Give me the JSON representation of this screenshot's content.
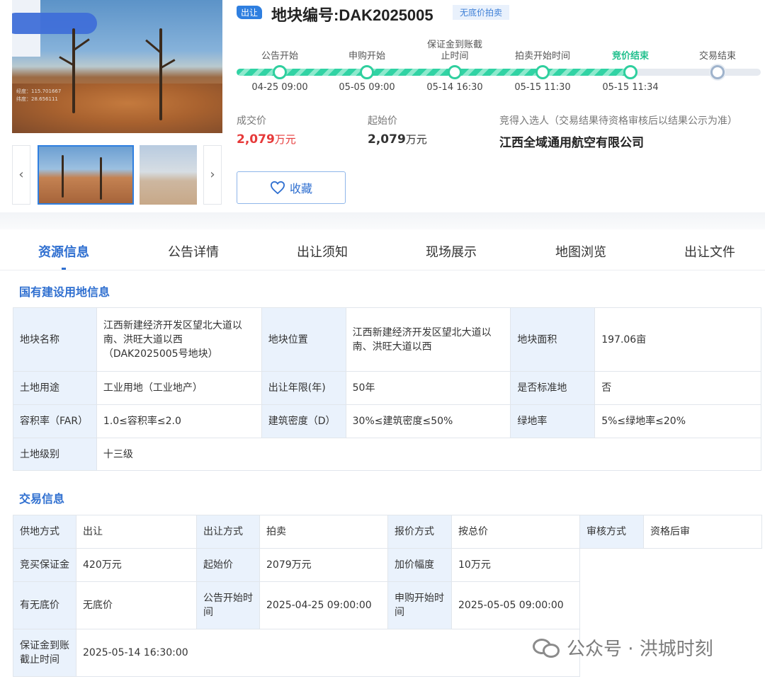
{
  "plot": {
    "tag": "出让",
    "title": "地块编号:DAK2025005",
    "auction_type_tag": "无底价拍卖",
    "photo_overlay_lines": [
      "经度：115.701667",
      "纬度：28.656111"
    ]
  },
  "gallery": {
    "prev_icon": "‹",
    "next_icon": "›"
  },
  "timeline": {
    "steps": [
      {
        "label": "公告开始",
        "date": "04-25 09:00",
        "done": true
      },
      {
        "label": "申购开始",
        "date": "05-05 09:00",
        "done": true
      },
      {
        "label": "保证金到账截止时间",
        "date": "05-14 16:30",
        "done": true
      },
      {
        "label": "拍卖开始时间",
        "date": "05-15 11:30",
        "done": true
      },
      {
        "label": "竞价结束",
        "date": "05-15 11:34",
        "done": true,
        "current": true
      },
      {
        "label": "交易结束",
        "date": "",
        "done": false
      }
    ],
    "progress_fraction": 0.75
  },
  "prices": {
    "deal_label": "成交价",
    "deal_value": "2,079",
    "deal_unit": "万元",
    "start_label": "起始价",
    "start_value": "2,079",
    "start_unit": "万元",
    "winner_label": "竞得入选人（交易结果待资格审核后以结果公示为准）",
    "winner_value": "江西全域通用航空有限公司"
  },
  "favorite": {
    "label": "收藏",
    "icon": "heart-icon"
  },
  "tabs": [
    "资源信息",
    "公告详情",
    "出让须知",
    "现场展示",
    "地图浏览",
    "出让文件"
  ],
  "land_info": {
    "title": "国有建设用地信息",
    "plot_name_label": "地块名称",
    "plot_name": "江西新建经济开发区望北大道以南、洪旺大道以西（DAK2025005号地块）",
    "location_label": "地块位置",
    "location": "江西新建经济开发区望北大道以南、洪旺大道以西",
    "area_label": "地块面积",
    "area": "197.06亩",
    "use_label": "土地用途",
    "use": "工业用地（工业地产）",
    "term_label": "出让年限(年)",
    "term": "50年",
    "standard_label": "是否标准地",
    "standard": "否",
    "far_label": "容积率（FAR）",
    "far": "1.0≤容积率≤2.0",
    "density_label": "建筑密度（D）",
    "density": "30%≤建筑密度≤50%",
    "green_label": "绿地率",
    "green": "5%≤绿地率≤20%",
    "grade_label": "土地级别",
    "grade": "十三级"
  },
  "trade_info": {
    "title": "交易信息",
    "supply_label": "供地方式",
    "supply": "出让",
    "method_label": "出让方式",
    "method": "拍卖",
    "quote_label": "报价方式",
    "quote": "按总价",
    "review_label": "审核方式",
    "review": "资格后审",
    "deposit_label": "竞买保证金",
    "deposit": "420万元",
    "start_label": "起始价",
    "start": "2079万元",
    "increment_label": "加价幅度",
    "increment": "10万元",
    "floor_label": "有无底价",
    "floor": "无底价",
    "notice_start_label": "公告开始时间",
    "notice_start": "2025-04-25 09:00:00",
    "apply_start_label": "申购开始时间",
    "apply_start": "2025-05-05 09:00:00",
    "deposit_deadline_label": "保证金到账截止时间",
    "deposit_deadline": "2025-05-14 16:30:00"
  },
  "watermark": {
    "text": "公众号 · 洪城时刻",
    "icon": "wechat-icon"
  }
}
